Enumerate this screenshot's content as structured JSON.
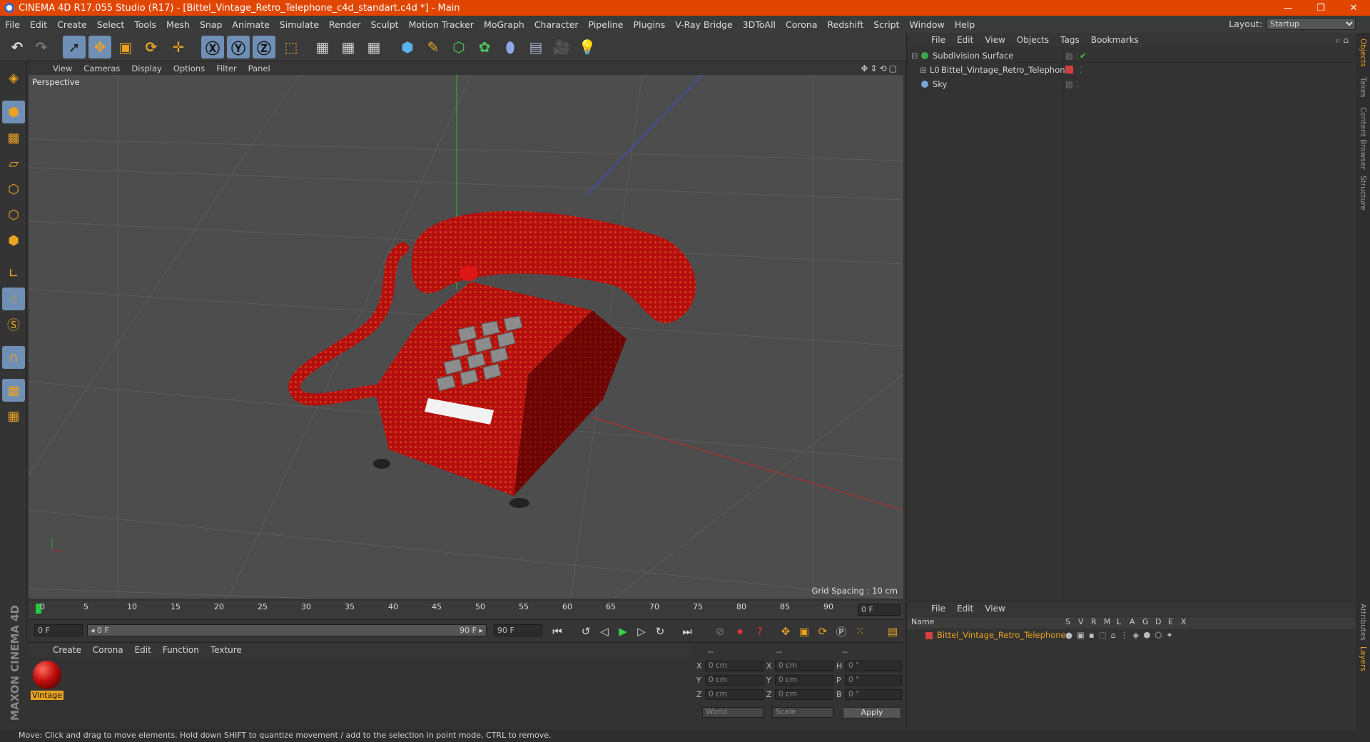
{
  "window": {
    "title": "CINEMA 4D R17.055 Studio (R17) - [Bittel_Vintage_Retro_Telephone_c4d_standart.c4d *] - Main",
    "minimize": "—",
    "maximize": "❐",
    "close": "✕"
  },
  "menubar": {
    "items": [
      "File",
      "Edit",
      "Create",
      "Select",
      "Tools",
      "Mesh",
      "Snap",
      "Animate",
      "Simulate",
      "Render",
      "Sculpt",
      "Motion Tracker",
      "MoGraph",
      "Character",
      "Pipeline",
      "Plugins",
      "V-Ray Bridge",
      "3DToAll",
      "Corona",
      "Redshift",
      "Script",
      "Window",
      "Help"
    ],
    "layout_label": "Layout:",
    "layout_value": "Startup"
  },
  "viewport": {
    "menu": [
      "View",
      "Cameras",
      "Display",
      "Options",
      "Filter",
      "Panel"
    ],
    "label": "Perspective",
    "grid_spacing": "Grid Spacing : 10 cm",
    "nav_icons": "✥⇕⟲▢"
  },
  "timeline": {
    "ticks": [
      "0",
      "5",
      "10",
      "15",
      "20",
      "25",
      "30",
      "35",
      "40",
      "45",
      "50",
      "55",
      "60",
      "65",
      "70",
      "75",
      "80",
      "85",
      "90"
    ],
    "current_frame": "0 F",
    "start": "0 F",
    "range_start": "◂ 0 F",
    "range_end": "90 F ▸",
    "end": "90 F"
  },
  "material_panel": {
    "menu": [
      "Create",
      "Corona",
      "Edit",
      "Function",
      "Texture"
    ],
    "material_name": "Vintage"
  },
  "coordinates": {
    "headers": [
      "--",
      "--",
      "--"
    ],
    "rows": [
      {
        "a": "X",
        "av": "0 cm",
        "b": "X",
        "bv": "0 cm",
        "c": "H",
        "cv": "0 °"
      },
      {
        "a": "Y",
        "av": "0 cm",
        "b": "Y",
        "bv": "0 cm",
        "c": "P",
        "cv": "0 °"
      },
      {
        "a": "Z",
        "av": "0 cm",
        "b": "Z",
        "bv": "0 cm",
        "c": "B",
        "cv": "0 °"
      }
    ],
    "space": "World",
    "mode": "Scale",
    "apply": "Apply"
  },
  "object_manager": {
    "menu": [
      "File",
      "Edit",
      "View",
      "Objects",
      "Tags",
      "Bookmarks"
    ],
    "objects": [
      {
        "name": "Subdivision Surface",
        "color": "#3aa84a",
        "indent": 0
      },
      {
        "name": "Bittel_Vintage_Retro_Telephone",
        "color": "#d24040",
        "indent": 1
      },
      {
        "name": "Sky",
        "color": "#7aa4d8",
        "indent": 0
      }
    ]
  },
  "layer_manager": {
    "menu": [
      "File",
      "Edit",
      "View"
    ],
    "columns": [
      "Name",
      "S",
      "V",
      "R",
      "M",
      "L",
      "A",
      "G",
      "D",
      "E",
      "X"
    ],
    "layer_name": "Bittel_Vintage_Retro_Telephone"
  },
  "right_tabs": [
    "Objects",
    "Takes",
    "Content Browser",
    "Structure"
  ],
  "right_tabs_lower": [
    "Attributes",
    "Layers"
  ],
  "status": "Move: Click and drag to move elements. Hold down SHIFT to quantize movement / add to the selection in point mode, CTRL to remove.",
  "brand": "MAXON CINEMA 4D",
  "colors": {
    "titlebar": "#e04600",
    "accent": "#e9a321",
    "selected_tool": "#6f8fb5",
    "phone_red": "#b80f0f"
  }
}
